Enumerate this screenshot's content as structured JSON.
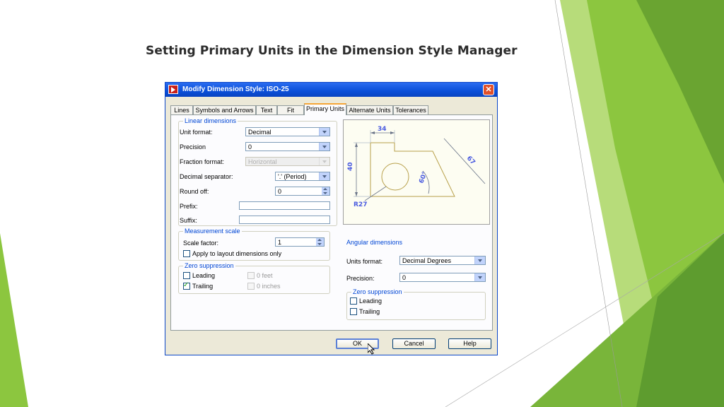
{
  "slide": {
    "title": "Setting  Primary Units  in the  Dimension Style Manager",
    "accent_colors": [
      "#8cc63f",
      "#6aa431",
      "#b7dc7a",
      "#4f8a2a"
    ]
  },
  "dialog": {
    "title": "Modify Dimension Style: ISO-25",
    "close_icon": "close-icon",
    "tabs": [
      "Lines",
      "Symbols and Arrows",
      "Text",
      "Fit",
      "Primary Units",
      "Alternate Units",
      "Tolerances"
    ],
    "active_tab": "Primary Units",
    "linear": {
      "group_label": "Linear dimensions",
      "unit_format_label": "Unit format:",
      "unit_format_value": "Decimal",
      "precision_label": "Precision",
      "precision_value": "0",
      "fraction_format_label": "Fraction format:",
      "fraction_format_value": "Horizontal",
      "decimal_separator_label": "Decimal separator:",
      "decimal_separator_value": "'.' (Period)",
      "round_off_label": "Round off:",
      "round_off_value": "0",
      "prefix_label": "Prefix:",
      "prefix_value": "",
      "suffix_label": "Suffix:",
      "suffix_value": ""
    },
    "measurement": {
      "group_label": "Measurement scale",
      "scale_factor_label": "Scale factor:",
      "scale_factor_value": "1",
      "apply_layout_label": "Apply to layout dimensions only"
    },
    "zero_suppression": {
      "group_label": "Zero suppression",
      "leading_label": "Leading",
      "trailing_label": "Trailing",
      "feet_label": "0 feet",
      "inches_label": "0 inches"
    },
    "preview": {
      "dim_top": "34",
      "dim_left": "40",
      "dim_diag": "67",
      "dim_angle": "60°",
      "dim_radius": "R27"
    },
    "angular": {
      "group_label": "Angular dimensions",
      "units_format_label": "Units format:",
      "units_format_value": "Decimal Degrees",
      "precision_label": "Precision:",
      "precision_value": "0",
      "zero_group_label": "Zero suppression",
      "leading_label": "Leading",
      "trailing_label": "Trailing"
    },
    "buttons": {
      "ok": "OK",
      "cancel": "Cancel",
      "help": "Help"
    }
  }
}
